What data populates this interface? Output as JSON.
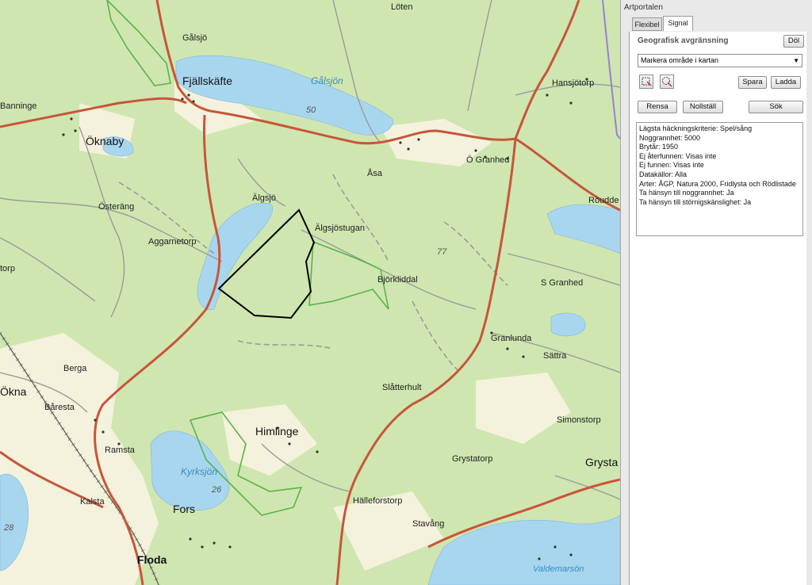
{
  "map": {
    "labels": [
      {
        "key": "loten",
        "text": "Löten"
      },
      {
        "key": "galsjo",
        "text": "Gålsjö"
      },
      {
        "key": "fjallskafte",
        "text": "Fjällskäfte"
      },
      {
        "key": "galsjon",
        "text": "Gålsjön"
      },
      {
        "key": "hansjotorp",
        "text": "Hansjötorp"
      },
      {
        "key": "banninge",
        "text": "Banninge"
      },
      {
        "key": "oknaby",
        "text": "Öknaby"
      },
      {
        "key": "num50",
        "text": "50"
      },
      {
        "key": "asa",
        "text": "Åsa"
      },
      {
        "key": "ogranhed",
        "text": "Ö Granhed"
      },
      {
        "key": "algsjo",
        "text": "Älgsjö"
      },
      {
        "key": "osterang",
        "text": "Österäng"
      },
      {
        "key": "roudde",
        "text": "Röudde"
      },
      {
        "key": "algsjostugan",
        "text": "Älgsjöstugan"
      },
      {
        "key": "aggarnetorp",
        "text": "Aggarnetorp"
      },
      {
        "key": "num77",
        "text": "77"
      },
      {
        "key": "torp",
        "text": "torp"
      },
      {
        "key": "bjorkliddal",
        "text": "Björkliddal"
      },
      {
        "key": "sgranhed",
        "text": "S Granhed"
      },
      {
        "key": "granlunda",
        "text": "Granlunda"
      },
      {
        "key": "sattra",
        "text": "Sättra"
      },
      {
        "key": "berga",
        "text": "Berga"
      },
      {
        "key": "okna",
        "text": "Ökna"
      },
      {
        "key": "slatterhult",
        "text": "Slåtterhult"
      },
      {
        "key": "baresta",
        "text": "Båresta"
      },
      {
        "key": "simonstorp",
        "text": "Simonstorp"
      },
      {
        "key": "himlinge",
        "text": "Himlinge"
      },
      {
        "key": "ramsta",
        "text": "Ramsta"
      },
      {
        "key": "grystatorp",
        "text": "Grystatorp"
      },
      {
        "key": "grysta",
        "text": "Grysta"
      },
      {
        "key": "kyrksjon",
        "text": "Kyrksjön"
      },
      {
        "key": "num26",
        "text": "26"
      },
      {
        "key": "kalsta",
        "text": "Kalsta"
      },
      {
        "key": "fors",
        "text": "Fors"
      },
      {
        "key": "halleforstorp",
        "text": "Hälleforstorp"
      },
      {
        "key": "num28",
        "text": "28"
      },
      {
        "key": "stavang",
        "text": "Stavång"
      },
      {
        "key": "floda",
        "text": "Floda"
      },
      {
        "key": "valdemarson",
        "text": "Valdemarsön"
      }
    ]
  },
  "panel": {
    "title": "Artportalen",
    "tabs": [
      "Flexibel",
      "Signal"
    ],
    "section_title": "Geografisk avgränsning",
    "hide_button": "Döl",
    "select_value": "Markera område i kartan",
    "save_button": "Spara",
    "load_button": "Ladda",
    "clear_button": "Rensa",
    "reset_button": "Nollställ",
    "search_button": "Sök",
    "icons": [
      "draw-area-icon",
      "select-area-icon"
    ],
    "info_lines": [
      "Lägsta häckningskriterie: Spel/sång",
      "Noggrannhet: 5000",
      "Brytår: 1950",
      "Ej återfunnen: Visas inte",
      "Ej funnen: Visas inte",
      "Datakällor: Alla",
      "Arter: ÅGP, Natura 2000, Fridlysta och Rödlistade",
      "Ta hänsyn till noggrannhet: Ja",
      "Ta hänsyn till störnigskänslighet: Ja"
    ]
  }
}
